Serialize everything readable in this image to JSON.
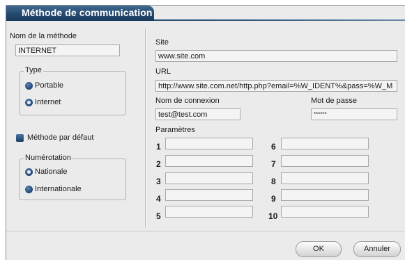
{
  "window": {
    "title": "Méthode de communication"
  },
  "method": {
    "label": "Nom de la méthode",
    "value": "INTERNET"
  },
  "type_group": {
    "legend": "Type",
    "options": [
      {
        "label": "Portable",
        "checked": false
      },
      {
        "label": "Internet",
        "checked": true
      }
    ]
  },
  "default_method": {
    "label": "Méthode par défaut"
  },
  "numbering_group": {
    "legend": "Numérotation",
    "options": [
      {
        "label": "Nationale",
        "checked": true
      },
      {
        "label": "Internationale",
        "checked": false
      }
    ]
  },
  "site": {
    "label": "Site",
    "value": "www.site.com"
  },
  "url": {
    "label": "URL",
    "value": "http://www.site.com.net/http.php?email=%W_IDENT%&pass=%W_M"
  },
  "login": {
    "label": "Nom de connexion",
    "value": "test@test.com"
  },
  "password": {
    "label": "Mot de passe",
    "value": "******"
  },
  "params": {
    "label": "Paramètres",
    "numbers": [
      "1",
      "2",
      "3",
      "4",
      "5",
      "6",
      "7",
      "8",
      "9",
      "10"
    ]
  },
  "buttons": {
    "ok": "OK",
    "cancel": "Annuler"
  }
}
